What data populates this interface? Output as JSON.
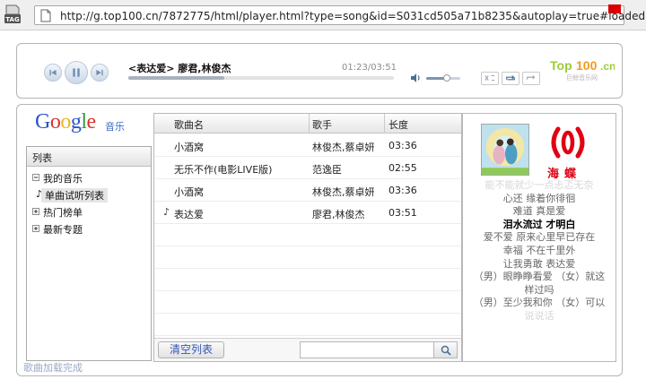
{
  "browser": {
    "url": "http://g.top100.cn/7872775/html/player.html?type=song&id=S031cd505a71b8235&autoplay=true#loaded",
    "tag_label": "TAG"
  },
  "player": {
    "now_playing": "<表达爱> 廖君,林俊杰",
    "time": "01:23/03:51",
    "progress": 0.36,
    "volume": 0.6,
    "brand": "Top100.cn",
    "brand_sub": "巨鲸音乐网"
  },
  "logo": {
    "google": [
      "G",
      "o",
      "o",
      "g",
      "l",
      "e"
    ],
    "colors": [
      "#2a55c9",
      "#d8342a",
      "#eeb423",
      "#2a55c9",
      "#2f9b3a",
      "#d8342a"
    ],
    "sub": "音乐"
  },
  "sidebar": {
    "header": "列表",
    "items": [
      {
        "label": "我的音乐",
        "type": "collapse"
      },
      {
        "label": "单曲试听列表",
        "type": "child"
      },
      {
        "label": "热门榜单",
        "type": "expand"
      },
      {
        "label": "最新专题",
        "type": "expand"
      }
    ]
  },
  "list": {
    "columns": [
      "歌曲名",
      "歌手",
      "长度"
    ],
    "rows": [
      {
        "title": "小酒窝",
        "artist": "林俊杰,蔡卓妍",
        "length": "03:36",
        "playing": false
      },
      {
        "title": "无乐不作(电影LIVE版)",
        "artist": "范逸臣",
        "length": "02:55",
        "playing": false
      },
      {
        "title": "小酒窝",
        "artist": "林俊杰,蔡卓妍",
        "length": "03:36",
        "playing": false
      },
      {
        "title": "表达爱",
        "artist": "廖君,林俊杰",
        "length": "03:51",
        "playing": true
      }
    ],
    "clear_button": "清空列表",
    "search_placeholder": ""
  },
  "side": {
    "badge_text": "海蝶",
    "lyrics": [
      {
        "text": "能不能就少一点忐忑无奈",
        "style": "faded"
      },
      {
        "text": "心还 缘着你徘徊",
        "style": "normal"
      },
      {
        "text": "难道 真是爱",
        "style": "normal"
      },
      {
        "text": "泪水流过 才明白",
        "style": "current"
      },
      {
        "text": "爱不爱 原来心里早已存在",
        "style": "normal"
      },
      {
        "text": "幸福 不在千里外",
        "style": "normal"
      },
      {
        "text": "让我勇敢 表达爱",
        "style": "normal"
      },
      {
        "text": "（男）眼睁睁看爱 （女）就这",
        "style": "normal"
      },
      {
        "text": "样过吗",
        "style": "normal"
      },
      {
        "text": "（男）至少我和你 （女）可以",
        "style": "normal"
      },
      {
        "text": "说说话",
        "style": "faded"
      }
    ]
  },
  "status_text": "歌曲加载完成"
}
